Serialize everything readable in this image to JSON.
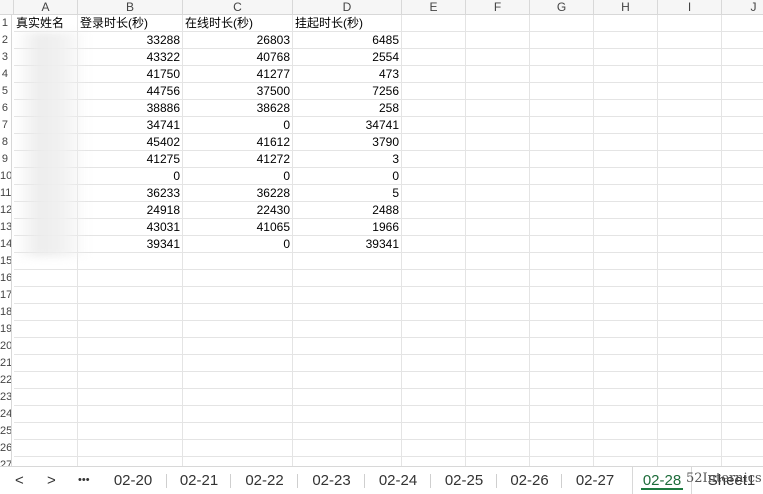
{
  "columns": [
    "A",
    "B",
    "C",
    "D",
    "E",
    "F",
    "G",
    "H",
    "I",
    "J"
  ],
  "row_numbers": [
    "1",
    "2",
    "3",
    "4",
    "5",
    "6",
    "7",
    "8",
    "9",
    "10",
    "11",
    "12",
    "13",
    "14",
    "15",
    "16",
    "17",
    "18",
    "19",
    "20",
    "21",
    "22",
    "23",
    "24",
    "25",
    "26",
    "27"
  ],
  "header_row": [
    "真实姓名",
    "登录时长(秒)",
    "在线时长(秒)",
    "挂起时长(秒)"
  ],
  "rows": [
    {
      "name": "",
      "login": "33288",
      "online": "26803",
      "hang": "6485"
    },
    {
      "name": "",
      "login": "43322",
      "online": "40768",
      "hang": "2554"
    },
    {
      "name": "",
      "login": "41750",
      "online": "41277",
      "hang": "473"
    },
    {
      "name": "",
      "login": "44756",
      "online": "37500",
      "hang": "7256"
    },
    {
      "name": "",
      "login": "38886",
      "online": "38628",
      "hang": "258"
    },
    {
      "name": "",
      "login": "34741",
      "online": "0",
      "hang": "34741"
    },
    {
      "name": "",
      "login": "45402",
      "online": "41612",
      "hang": "3790"
    },
    {
      "name": "",
      "login": "41275",
      "online": "41272",
      "hang": "3"
    },
    {
      "name": "",
      "login": "0",
      "online": "0",
      "hang": "0"
    },
    {
      "name": "",
      "login": "36233",
      "online": "36228",
      "hang": "5"
    },
    {
      "name": "",
      "login": "24918",
      "online": "22430",
      "hang": "2488"
    },
    {
      "name": "",
      "login": "43031",
      "online": "41065",
      "hang": "1966"
    },
    {
      "name": "",
      "login": "39341",
      "online": "0",
      "hang": "39341"
    }
  ],
  "tabs": {
    "prev_label": "<",
    "next_label": ">",
    "more_label": "•••",
    "items": [
      "02-20",
      "02-21",
      "02-22",
      "02-23",
      "02-24",
      "02-25",
      "02-26",
      "02-27",
      "02-28",
      "Sheet1"
    ],
    "active": "02-28",
    "watermark": "52Internics"
  },
  "colors": {
    "accent": "#1e7a40",
    "gridline": "#e4e4e4"
  }
}
